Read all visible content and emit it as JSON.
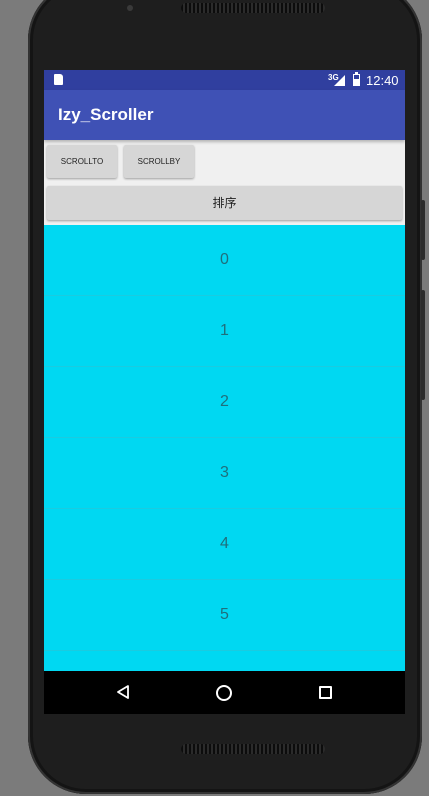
{
  "status_bar": {
    "network_label": "3G",
    "time": "12:40",
    "icons": [
      "sd-card-icon",
      "signal-icon",
      "battery-icon"
    ]
  },
  "app_bar": {
    "title": "Izy_Scroller"
  },
  "buttons": {
    "scroll_to": "SCROLLTO",
    "scroll_by": "SCROLLBY",
    "sort": "排序"
  },
  "list": {
    "items": [
      "0",
      "1",
      "2",
      "3",
      "4",
      "5"
    ],
    "background_color": "#00d8f2"
  },
  "nav_bar": {
    "icons": [
      "back-icon",
      "home-icon",
      "recents-icon"
    ]
  },
  "colors": {
    "status_bar": "#303f9f",
    "app_bar": "#3f51b5",
    "list_background": "#00d8f2"
  }
}
